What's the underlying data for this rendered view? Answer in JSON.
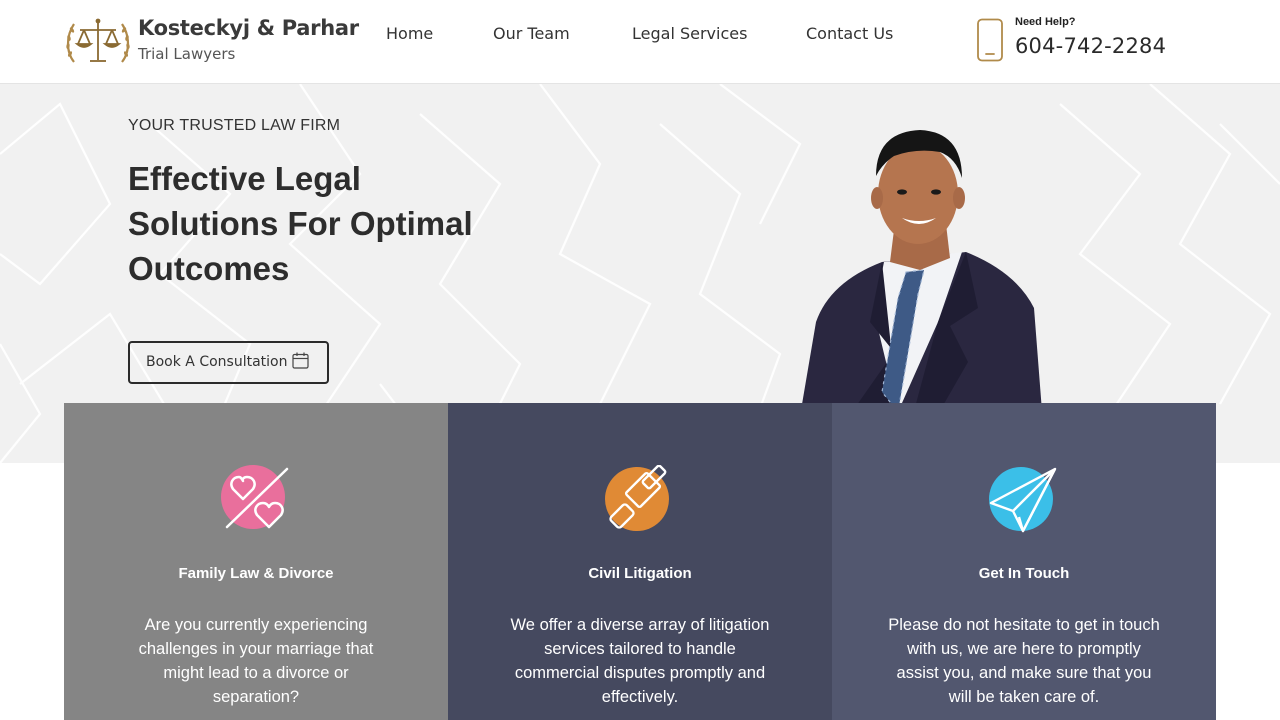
{
  "header": {
    "logo": {
      "name": "Kosteckyj & Parhar",
      "subtitle": "Trial Lawyers",
      "emblem_icon": "scales-of-justice-icon"
    },
    "nav": [
      {
        "label": "Home"
      },
      {
        "label": "Our Team"
      },
      {
        "label": "Legal Services"
      },
      {
        "label": "Contact Us"
      }
    ],
    "help": {
      "label": "Need Help?",
      "phone": "604-742-2284",
      "icon": "mobile-phone-icon"
    }
  },
  "hero": {
    "eyebrow": "YOUR TRUSTED LAW FIRM",
    "headline": "Effective Legal Solutions For Optimal Outcomes",
    "cta": {
      "label": "Book A Consultation",
      "icon": "calendar-icon"
    }
  },
  "cards": [
    {
      "title": "Family Law & Divorce",
      "text": "Are you currently experiencing challenges in your marriage that might lead to a divorce or separation?",
      "icon": "broken-hearts-icon",
      "icon_color": "#e96f9c",
      "bg": "#858585"
    },
    {
      "title": "Civil Litigation",
      "text": "We offer a diverse array of litigation services tailored to handle commercial disputes promptly and effectively.",
      "icon": "gavel-icon",
      "icon_color": "#e08a35",
      "bg": "#45495f"
    },
    {
      "title": "Get In Touch",
      "text": "Please do not hesitate to get in touch with us, we are here to promptly assist you, and make sure that you will be taken care of.",
      "icon": "paper-plane-icon",
      "icon_color": "#3bbfe8",
      "bg": "#52576f"
    }
  ],
  "colors": {
    "accent_gold": "#b08a4a",
    "text_dark": "#2b2b2b",
    "hero_bg": "#f1f1f1"
  }
}
